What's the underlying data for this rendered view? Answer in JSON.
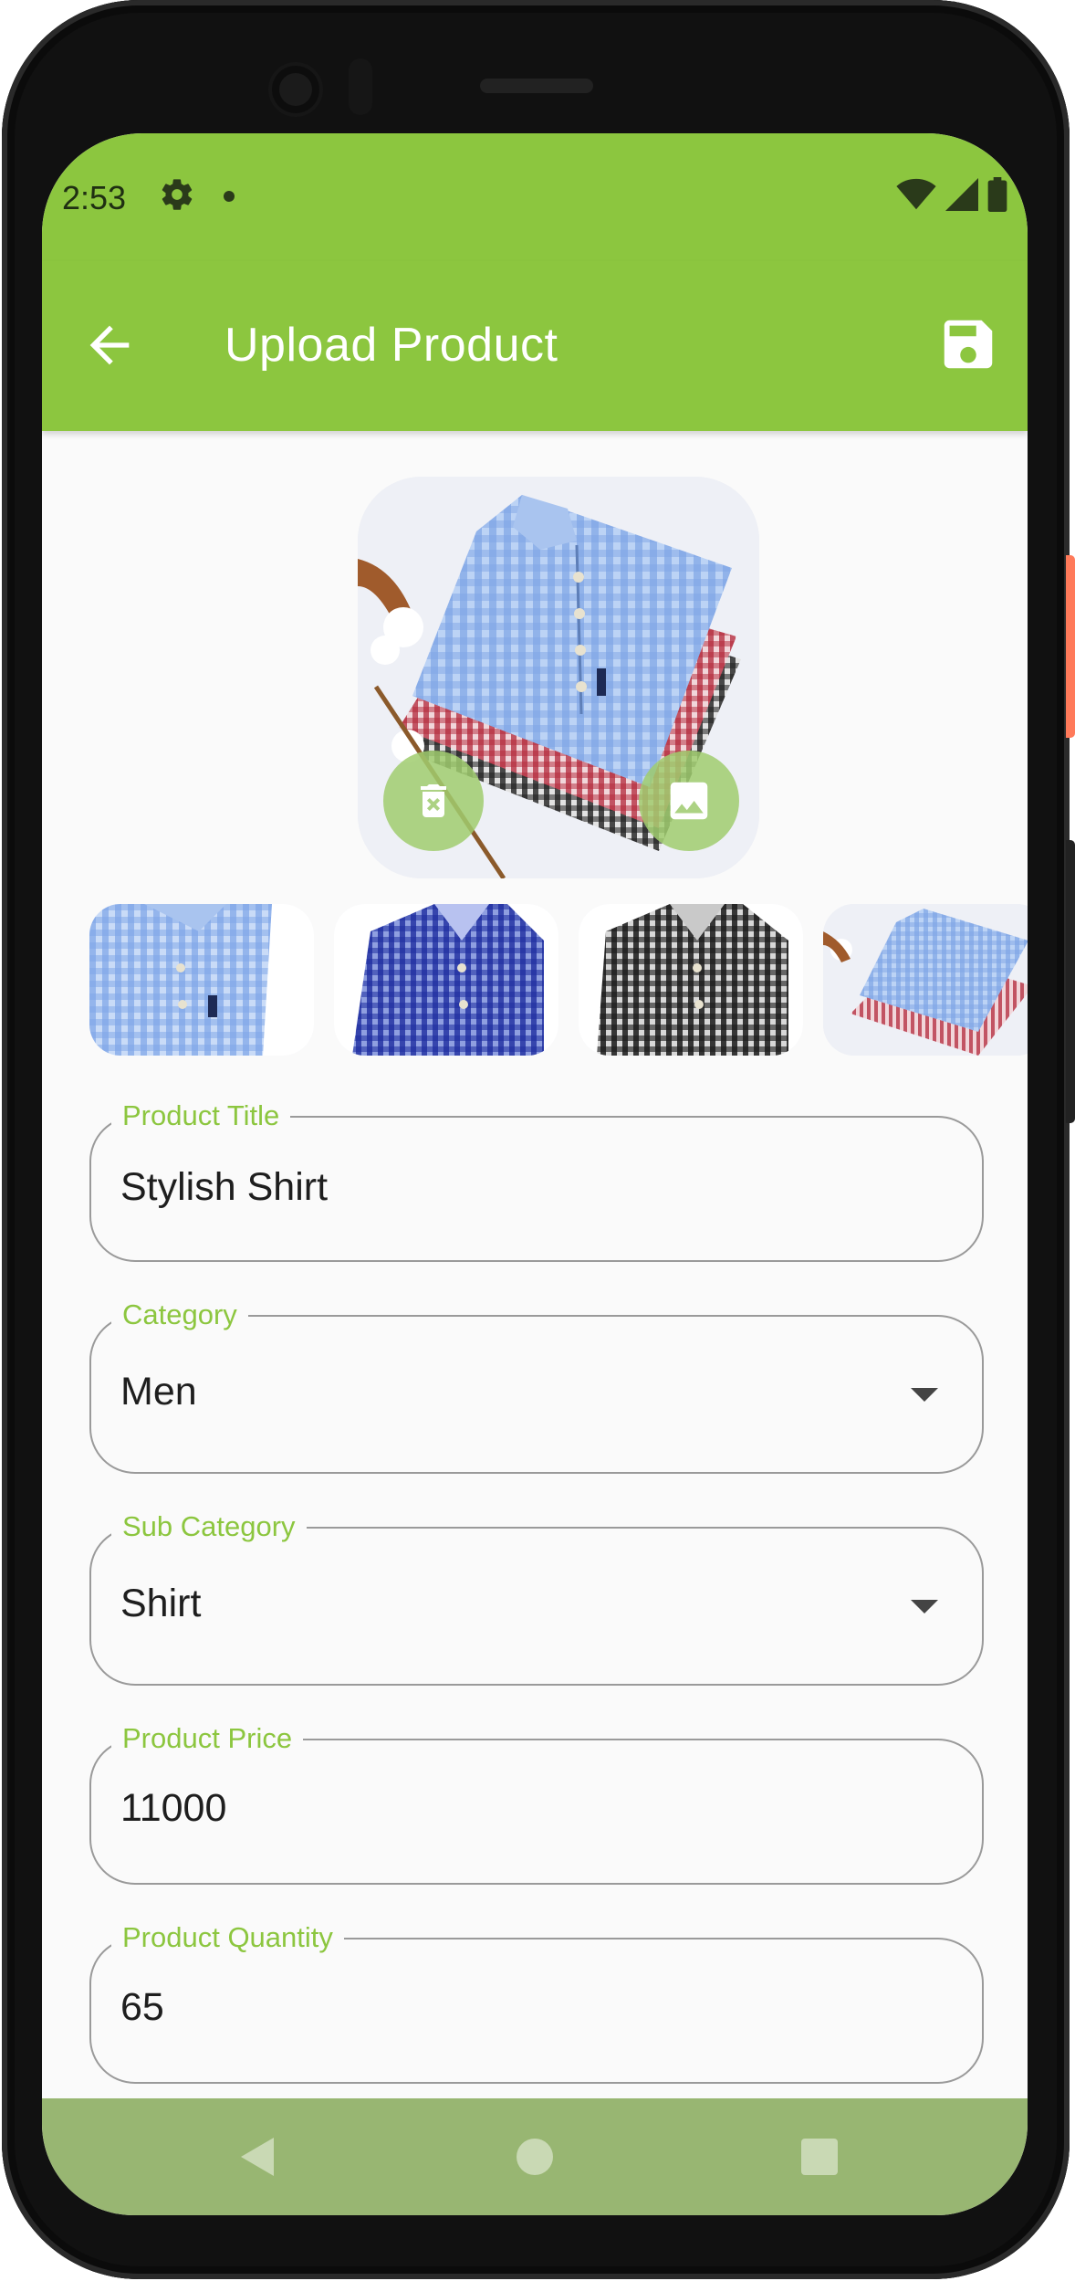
{
  "status_bar": {
    "time": "2:53",
    "icons": [
      "gear-icon",
      "dot-icon",
      "wifi-icon",
      "signal-icon",
      "battery-icon"
    ]
  },
  "app_bar": {
    "title": "Upload Product",
    "back_icon": "arrow-left-icon",
    "save_icon": "save-icon",
    "background": "#8cc63f"
  },
  "images": {
    "delete_icon": "trash-icon",
    "gallery_icon": "image-icon",
    "thumbnail_count": 4
  },
  "form": {
    "title": {
      "label": "Product Title",
      "value": "Stylish Shirt"
    },
    "category": {
      "label": "Category",
      "value": "Men"
    },
    "sub_category": {
      "label": "Sub Category",
      "value": "Shirt"
    },
    "price": {
      "label": "Product Price",
      "value": "11000"
    },
    "quantity": {
      "label": "Product Quantity",
      "value": "65"
    }
  },
  "colors": {
    "accent": "#8cc63f",
    "nav_bar": "#98b672",
    "field_border": "#9a9a9a"
  },
  "nav": {
    "back_icon": "nav-back-icon",
    "home_icon": "nav-home-icon",
    "recents_icon": "nav-recents-icon"
  }
}
